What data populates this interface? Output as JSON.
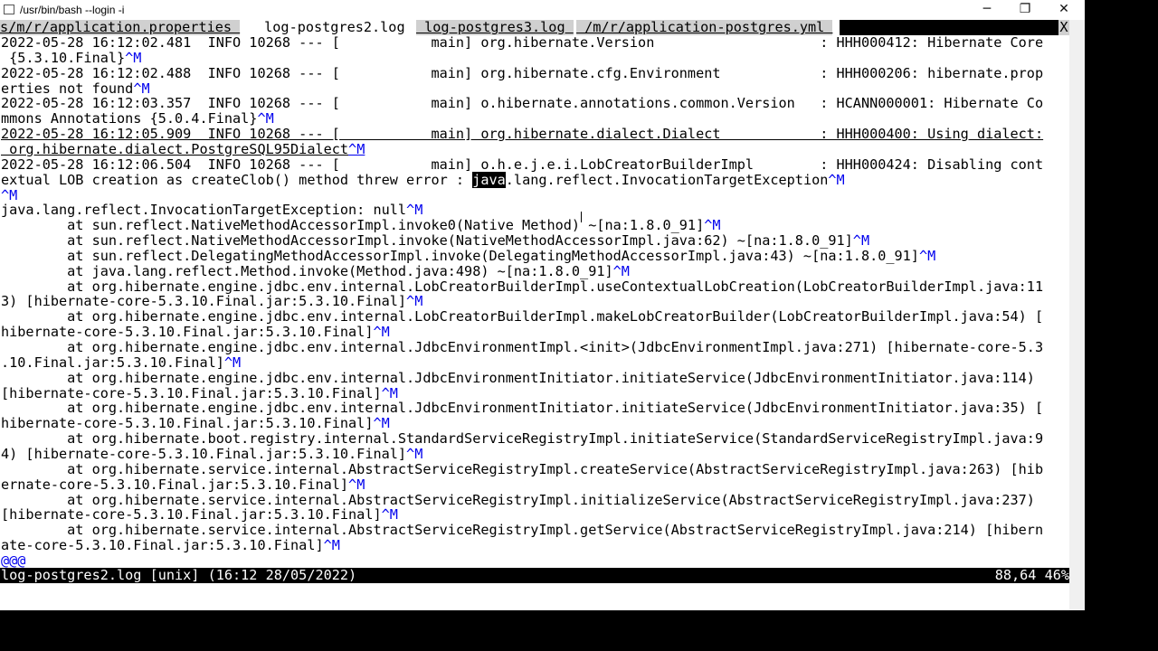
{
  "window": {
    "title": "/usr/bin/bash --login -i",
    "minimize": "─",
    "maximize": "❐",
    "close": "✕"
  },
  "tabs": [
    {
      "label": "s/m/r/application.properties ",
      "active": false
    },
    {
      "label": " log-postgres2.log ",
      "active": true
    },
    {
      "label": " log-postgres3.log ",
      "active": false
    },
    {
      "label": " /m/r/application-postgres.yml ",
      "active": false
    }
  ],
  "tab_close": "X",
  "lines": [
    {
      "t": "2022-05-28 16:12:02.481  INFO 10268 --- [           main] org.hibernate.Version                    : HHH000412: Hibernate Core"
    },
    {
      "t": " {5.3.10.Final}",
      "m": "^M"
    },
    {
      "t": "2022-05-28 16:12:02.488  INFO 10268 --- [           main] org.hibernate.cfg.Environment            : HHH000206: hibernate.prop"
    },
    {
      "t": "erties not found",
      "m": "^M"
    },
    {
      "t": "2022-05-28 16:12:03.357  INFO 10268 --- [           main] o.hibernate.annotations.common.Version   : HCANN000001: Hibernate Co"
    },
    {
      "t": "mmons Annotations {5.0.4.Final}",
      "m": "^M"
    },
    {
      "t": "2022-05-28 16:12:05.909  INFO 10268 --- [           main] org.hibernate.dialect.Dialect            : HHH000400: Using dialect:",
      "u": true
    },
    {
      "t": " org.hibernate.dialect.PostgreSQL95Dialect",
      "m": "^M",
      "u": true
    },
    {
      "t": "2022-05-28 16:12:06.504  INFO 10268 --- [           main] o.h.e.j.e.i.LobCreatorBuilderImpl        : HHH000424: Disabling cont"
    },
    {
      "t": "extual LOB creation as createClob() method threw error : ",
      "h": "java",
      "a": ".lang.reflect.InvocationTargetException",
      "m": "^M"
    },
    {
      "t": "",
      "m": "^M"
    },
    {
      "t": "java.lang.reflect.InvocationTargetException: null",
      "m": "^M"
    },
    {
      "t": "        at sun.reflect.NativeMethodAccessorImpl.invoke0(Native Method) ~[na:1.8.0_91]",
      "m": "^M"
    },
    {
      "t": "        at sun.reflect.NativeMethodAccessorImpl.invoke(NativeMethodAccessorImpl.java:62) ~[na:1.8.0_91]",
      "m": "^M"
    },
    {
      "t": "        at sun.reflect.DelegatingMethodAccessorImpl.invoke(DelegatingMethodAccessorImpl.java:43) ~[na:1.8.0_91]",
      "m": "^M"
    },
    {
      "t": "        at java.lang.reflect.Method.invoke(Method.java:498) ~[na:1.8.0_91]",
      "m": "^M"
    },
    {
      "t": "        at org.hibernate.engine.jdbc.env.internal.LobCreatorBuilderImpl.useContextualLobCreation(LobCreatorBuilderImpl.java:11"
    },
    {
      "t": "3) [hibernate-core-5.3.10.Final.jar:5.3.10.Final]",
      "m": "^M"
    },
    {
      "t": "        at org.hibernate.engine.jdbc.env.internal.LobCreatorBuilderImpl.makeLobCreatorBuilder(LobCreatorBuilderImpl.java:54) ["
    },
    {
      "t": "hibernate-core-5.3.10.Final.jar:5.3.10.Final]",
      "m": "^M"
    },
    {
      "t": "        at org.hibernate.engine.jdbc.env.internal.JdbcEnvironmentImpl.<init>(JdbcEnvironmentImpl.java:271) [hibernate-core-5.3"
    },
    {
      "t": ".10.Final.jar:5.3.10.Final]",
      "m": "^M"
    },
    {
      "t": "        at org.hibernate.engine.jdbc.env.internal.JdbcEnvironmentInitiator.initiateService(JdbcEnvironmentInitiator.java:114)"
    },
    {
      "t": "[hibernate-core-5.3.10.Final.jar:5.3.10.Final]",
      "m": "^M"
    },
    {
      "t": "        at org.hibernate.engine.jdbc.env.internal.JdbcEnvironmentInitiator.initiateService(JdbcEnvironmentInitiator.java:35) ["
    },
    {
      "t": "hibernate-core-5.3.10.Final.jar:5.3.10.Final]",
      "m": "^M"
    },
    {
      "t": "        at org.hibernate.boot.registry.internal.StandardServiceRegistryImpl.initiateService(StandardServiceRegistryImpl.java:9"
    },
    {
      "t": "4) [hibernate-core-5.3.10.Final.jar:5.3.10.Final]",
      "m": "^M"
    },
    {
      "t": "        at org.hibernate.service.internal.AbstractServiceRegistryImpl.createService(AbstractServiceRegistryImpl.java:263) [hib"
    },
    {
      "t": "ernate-core-5.3.10.Final.jar:5.3.10.Final]",
      "m": "^M"
    },
    {
      "t": "        at org.hibernate.service.internal.AbstractServiceRegistryImpl.initializeService(AbstractServiceRegistryImpl.java:237)"
    },
    {
      "t": "[hibernate-core-5.3.10.Final.jar:5.3.10.Final]",
      "m": "^M"
    },
    {
      "t": "        at org.hibernate.service.internal.AbstractServiceRegistryImpl.getService(AbstractServiceRegistryImpl.java:214) [hibern"
    },
    {
      "t": "ate-core-5.3.10.Final.jar:5.3.10.Final]",
      "m": "^M"
    },
    {
      "t": "",
      "at": "@@@"
    }
  ],
  "status": {
    "left": "log-postgres2.log [unix] (16:12 28/05/2022)",
    "right": "88,64 46%"
  }
}
